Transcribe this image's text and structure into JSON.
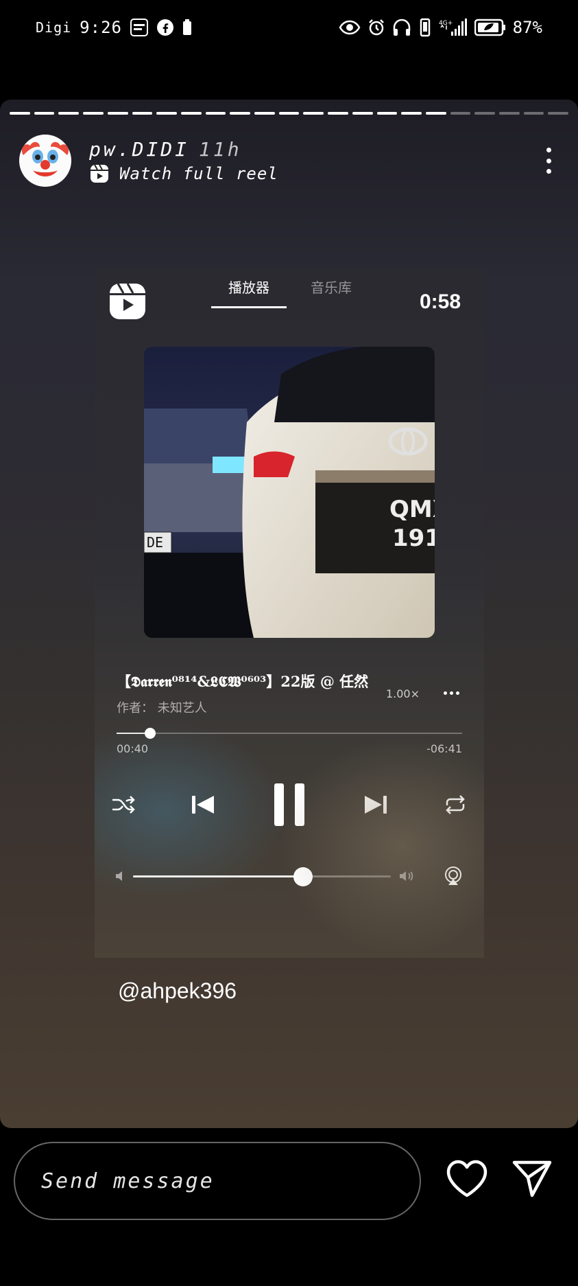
{
  "status_bar": {
    "carrier": "Digi",
    "time": "9:26",
    "battery": "87%"
  },
  "story": {
    "username": "pw.DIDI",
    "posted_ago": "11h",
    "watch_label": "Watch full reel",
    "progress_total_segments": 23,
    "progress_done_segments": 18,
    "mention": "@ahpek396"
  },
  "player": {
    "tabs": [
      {
        "label": "播放器",
        "active": true
      },
      {
        "label": "音乐库",
        "active": false
      }
    ],
    "timer": "0:58",
    "track_title": "【𝕯𝖆𝖗𝖗𝖊𝖓⁰⁸¹⁴&𝕷𝕮𝖂⁰⁶⁰³】22版 @ 任然",
    "track_artist": "作者： 未知艺人",
    "speed": "1.00×",
    "elapsed": "00:40",
    "remaining": "-06:41",
    "seek_progress": 0.097,
    "volume_level": 0.66
  },
  "bottom_bar": {
    "message_placeholder": "Send message"
  },
  "colors": {
    "accent": "#ffffff",
    "background": "#000000"
  }
}
